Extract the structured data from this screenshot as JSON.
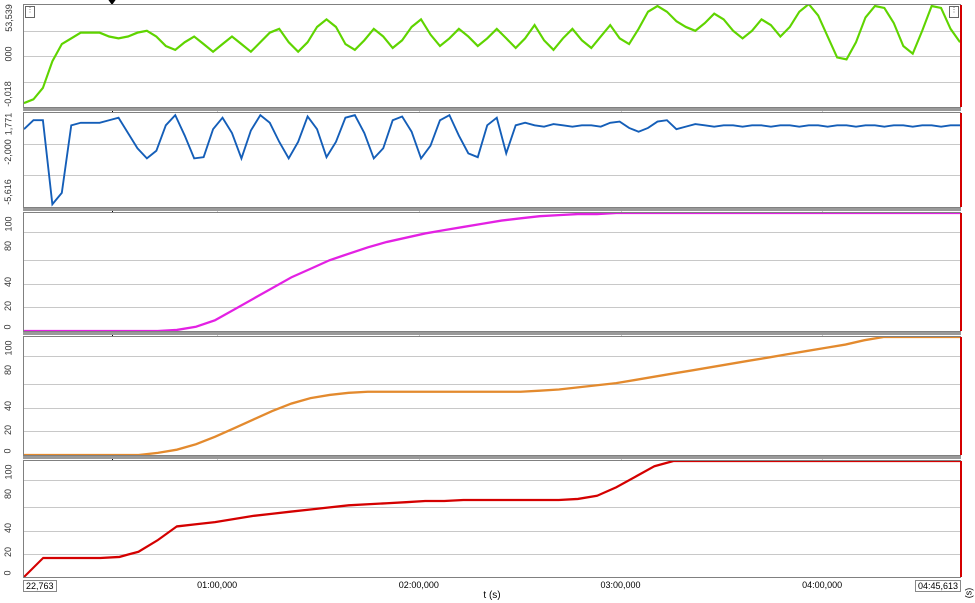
{
  "x_axis": {
    "label": "t (s)",
    "unit_right": "(s)",
    "start": "22,763",
    "end": "04:45,613",
    "ticks": [
      "01:00,000",
      "02:00,000",
      "03:00,000",
      "04:00,000"
    ]
  },
  "cursor_x_frac": 0.095,
  "panels": [
    {
      "name": "trace-1-green",
      "y_ticks": [
        "-0,018",
        "000",
        "53,539"
      ],
      "color": "#5fd400"
    },
    {
      "name": "trace-2-blue",
      "y_ticks": [
        "-5,616",
        "-2,000",
        "1,771"
      ],
      "color": "#145eb8"
    },
    {
      "name": "trace-3-magenta",
      "y_ticks": [
        "0",
        "20",
        "40",
        "80",
        "100"
      ],
      "color": "#e321e3"
    },
    {
      "name": "trace-4-orange",
      "y_ticks": [
        "0",
        "20",
        "40",
        "80",
        "100"
      ],
      "color": "#e38a2e"
    },
    {
      "name": "trace-5-red",
      "y_ticks": [
        "0",
        "20",
        "40",
        "80",
        "100"
      ],
      "color": "#d40000"
    }
  ],
  "chart_data": {
    "type": "line",
    "xlabel": "t (s)",
    "x_range_seconds": [
      22.763,
      285.613
    ],
    "x_ticks_seconds": [
      60,
      120,
      180,
      240
    ],
    "series": [
      {
        "name": "trace-1-green",
        "ylim": [
          -0.018,
          53.539
        ],
        "y": [
          2,
          4,
          10,
          24,
          33,
          36,
          39,
          39,
          39,
          37,
          36,
          37,
          39,
          40,
          37,
          32,
          30,
          34,
          37,
          33,
          29,
          33,
          37,
          33,
          29,
          34,
          39,
          41,
          34,
          29,
          34,
          42,
          46,
          42,
          33,
          30,
          35,
          41,
          37,
          31,
          35,
          42,
          46,
          38,
          32,
          36,
          41,
          37,
          32,
          36,
          41,
          36,
          31,
          36,
          43,
          35,
          30,
          36,
          41,
          35,
          31,
          37,
          43,
          36,
          33,
          41,
          50,
          53,
          50,
          45,
          42,
          40,
          44,
          49,
          46,
          40,
          36,
          40,
          46,
          43,
          37,
          42,
          50,
          54,
          48,
          37,
          26,
          25,
          34,
          47,
          53,
          52,
          44,
          32,
          28,
          40,
          53,
          52,
          41,
          34
        ],
        "x_frac_start": 0.0,
        "x_frac_end": 1.0
      },
      {
        "name": "trace-2-blue",
        "ylim": [
          -5.616,
          1.771
        ],
        "y": [
          0.5,
          1.2,
          1.2,
          -5.4,
          -4.5,
          0.8,
          1.0,
          1.0,
          1.0,
          1.2,
          1.4,
          0.2,
          -1.0,
          -1.8,
          -1.2,
          0.8,
          1.6,
          0.0,
          -1.8,
          -1.7,
          0.5,
          1.4,
          0.2,
          -1.8,
          0.4,
          1.6,
          1.0,
          -0.5,
          -1.8,
          -0.5,
          1.5,
          0.5,
          -1.7,
          -0.5,
          1.4,
          1.6,
          0.2,
          -1.8,
          -1.0,
          1.2,
          1.5,
          0.3,
          -1.8,
          -0.8,
          1.2,
          1.6,
          0.0,
          -1.4,
          -1.7,
          0.8,
          1.4,
          -1.4,
          0.8,
          1.0,
          0.8,
          0.7,
          0.9,
          0.8,
          0.7,
          0.8,
          0.8,
          0.7,
          1.0,
          1.1,
          0.6,
          0.3,
          0.6,
          1.1,
          1.2,
          0.5,
          0.7,
          0.9,
          0.8,
          0.7,
          0.8,
          0.8,
          0.7,
          0.8,
          0.8,
          0.7,
          0.8,
          0.8,
          0.7,
          0.8,
          0.8,
          0.7,
          0.8,
          0.8,
          0.7,
          0.8,
          0.8,
          0.7,
          0.8,
          0.8,
          0.7,
          0.8,
          0.8,
          0.7,
          0.8,
          0.8
        ],
        "x_frac_start": 0.0,
        "x_frac_end": 1.0
      },
      {
        "name": "trace-3-magenta",
        "ylim": [
          0,
          110
        ],
        "y": [
          0,
          0,
          0,
          0,
          0,
          0,
          0,
          0,
          1,
          4,
          10,
          20,
          30,
          40,
          50,
          58,
          66,
          72,
          78,
          83,
          87,
          91,
          94,
          97,
          100,
          103,
          105,
          107,
          108,
          109,
          109,
          110,
          110,
          110,
          110,
          110,
          110,
          110,
          110,
          110,
          110,
          110,
          110,
          110,
          110,
          110,
          110,
          110,
          110,
          110
        ],
        "x_frac_start": 0.0,
        "x_frac_end": 1.0
      },
      {
        "name": "trace-4-orange",
        "ylim": [
          0,
          110
        ],
        "y": [
          0,
          0,
          0,
          0,
          0,
          0,
          0,
          2,
          5,
          10,
          17,
          25,
          33,
          41,
          48,
          53,
          56,
          58,
          59,
          59,
          59,
          59,
          59,
          59,
          59,
          59,
          59,
          60,
          61,
          63,
          65,
          67,
          70,
          73,
          76,
          79,
          82,
          85,
          88,
          91,
          94,
          97,
          100,
          103,
          107,
          110,
          110,
          110,
          110,
          110
        ],
        "x_frac_start": 0.0,
        "x_frac_end": 1.0
      },
      {
        "name": "trace-5-red",
        "ylim": [
          0,
          110
        ],
        "y": [
          0,
          18,
          18,
          18,
          18,
          19,
          24,
          35,
          48,
          50,
          52,
          55,
          58,
          60,
          62,
          64,
          66,
          68,
          69,
          70,
          71,
          72,
          72,
          73,
          73,
          73,
          73,
          73,
          73,
          74,
          77,
          85,
          95,
          105,
          110,
          110,
          110,
          110,
          110,
          110,
          110,
          110,
          110,
          110,
          110,
          110,
          110,
          110,
          110,
          110
        ],
        "x_frac_start": 0.0,
        "x_frac_end": 1.0
      }
    ]
  }
}
